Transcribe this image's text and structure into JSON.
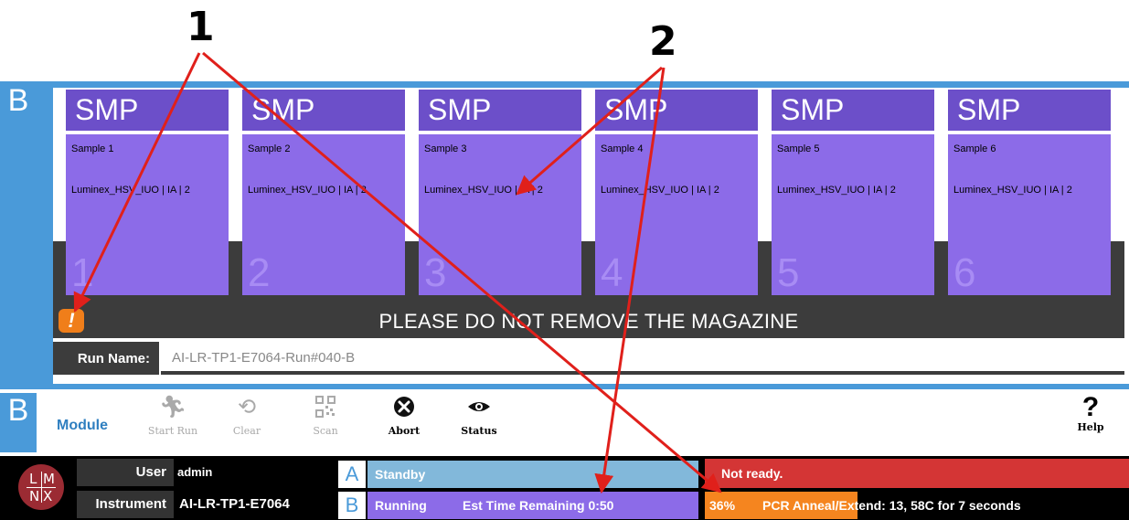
{
  "callouts": {
    "one": "1",
    "two": "2"
  },
  "module_b": {
    "letter": "B",
    "samples": [
      {
        "header": "SMP",
        "name": "Sample 1",
        "assay": "Luminex_HSV_IUO | IA | 2",
        "slot": "1"
      },
      {
        "header": "SMP",
        "name": "Sample 2",
        "assay": "Luminex_HSV_IUO | IA | 2",
        "slot": "2"
      },
      {
        "header": "SMP",
        "name": "Sample 3",
        "assay": "Luminex_HSV_IUO | IA | 2",
        "slot": "3"
      },
      {
        "header": "SMP",
        "name": "Sample 4",
        "assay": "Luminex_HSV_IUO | IA | 2",
        "slot": "4"
      },
      {
        "header": "SMP",
        "name": "Sample 5",
        "assay": "Luminex_HSV_IUO | IA | 2",
        "slot": "5"
      },
      {
        "header": "SMP",
        "name": "Sample 6",
        "assay": "Luminex_HSV_IUO | IA | 2",
        "slot": "6"
      }
    ],
    "banner": "PLEASE DO NOT REMOVE THE MAGAZINE",
    "run_name_label": "Run Name:",
    "run_name_value": "AI-LR-TP1-E7064-Run#040-B"
  },
  "toolbar": {
    "letter": "B",
    "module_label": "Module",
    "start_run": "Start Run",
    "clear": "Clear",
    "scan": "Scan",
    "abort": "Abort",
    "status": "Status",
    "help": "Help"
  },
  "status_bar": {
    "logo": {
      "tl": "L",
      "tr": "M",
      "bl": "N",
      "br": "X"
    },
    "user_label": "User",
    "user_value": "admin",
    "instrument_label": "Instrument",
    "instrument_value": "AI-LR-TP1-E7064",
    "module_a": {
      "letter": "A",
      "status": "Standby"
    },
    "module_b": {
      "letter": "B",
      "status": "Running",
      "est_time": "Est Time Remaining 0:50"
    },
    "not_ready": "Not ready.",
    "progress": {
      "percent_text": "36%",
      "percent": 36,
      "step": "PCR Anneal/Extend: 13, 58C for 7 seconds"
    }
  },
  "colors": {
    "module_blue": "#4a9ad9",
    "smp_header": "#6c4fc9",
    "smp_body": "#8c6be8",
    "warning_orange": "#f5851f",
    "alert_red": "#d43535",
    "standby_blue": "#82b8da"
  }
}
